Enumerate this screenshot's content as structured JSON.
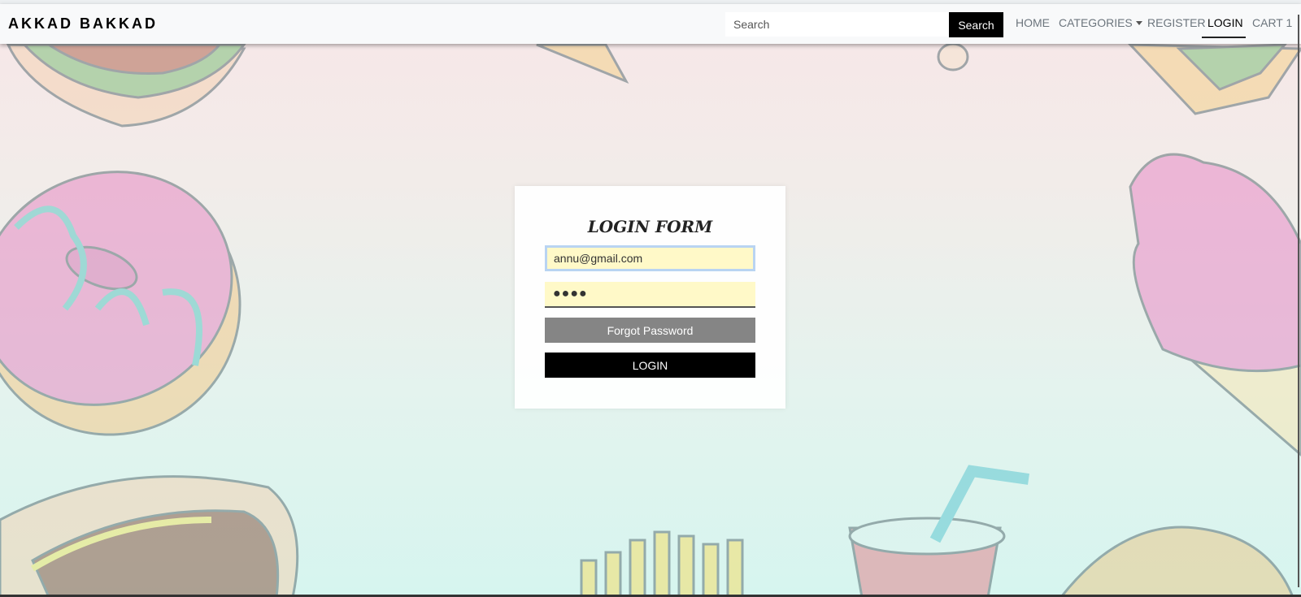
{
  "navbar": {
    "brand": "AKKAD BAKKAD",
    "search_placeholder": "Search",
    "search_button": "Search",
    "links": {
      "home": "HOME",
      "categories": "CATEGORIES",
      "register": "REGISTER",
      "login": "LOGIN",
      "cart": "CART 1"
    },
    "active_link": "login"
  },
  "login_form": {
    "title": "LOGIN FORM",
    "email_value": "annu@gmail.com",
    "password_mask": "●●●●",
    "forgot_button": "Forgot Password",
    "login_button": "LOGIN"
  },
  "colors": {
    "navbar_bg": "#f8f9fa",
    "input_bg": "#fff9c8",
    "forgot_bg": "#858585",
    "login_bg": "#000000"
  }
}
